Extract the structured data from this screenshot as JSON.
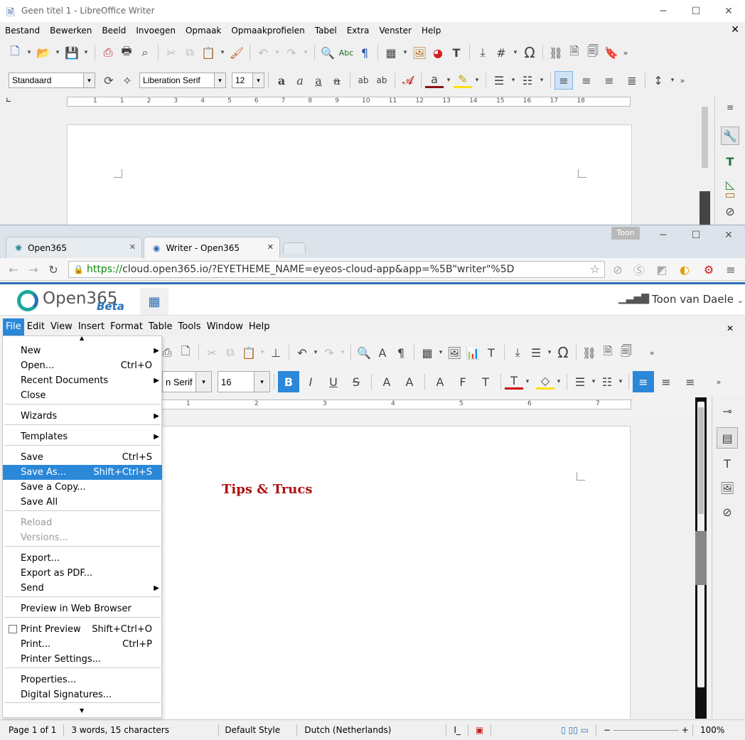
{
  "lo": {
    "title": "Geen titel 1 - LibreOffice Writer",
    "menu": [
      "Bestand",
      "Bewerken",
      "Beeld",
      "Invoegen",
      "Opmaak",
      "Opmaakprofielen",
      "Tabel",
      "Extra",
      "Venster",
      "Help"
    ],
    "style_value": "Standaard",
    "font_value": "Liberation Serif",
    "size_value": "12",
    "ruler_ticks": [
      "1",
      "1",
      "2",
      "3",
      "4",
      "5",
      "6",
      "7",
      "8",
      "9",
      "10",
      "11",
      "12",
      "13",
      "14",
      "15",
      "16",
      "17",
      "18"
    ]
  },
  "browser": {
    "user_badge": "Toon",
    "tabs": [
      {
        "label": "Open365"
      },
      {
        "label": "Writer - Open365"
      }
    ],
    "url_prefix": "https://",
    "url_rest": "cloud.open365.io/?EYETHEME_NAME=eyeos-cloud-app&app=%5B\"writer\"%5D"
  },
  "open365": {
    "logo_text": "Open365",
    "beta": "Beta",
    "user_name": "Toon van Daele",
    "menu": [
      "File",
      "Edit",
      "View",
      "Insert",
      "Format",
      "Table",
      "Tools",
      "Window",
      "Help"
    ],
    "font_value": "n Serif",
    "size_value": "16",
    "doc_heading": "Tips & Trucs",
    "ruler_ticks": [
      "1",
      "2",
      "3",
      "4",
      "5",
      "6",
      "7"
    ]
  },
  "file_menu": {
    "items": [
      {
        "label": "New",
        "accel": "",
        "submenu": true
      },
      {
        "label": "Open...",
        "accel": "Ctrl+O"
      },
      {
        "label": "Recent Documents",
        "accel": "",
        "submenu": true
      },
      {
        "label": "Close",
        "accel": ""
      },
      {
        "label": "Wizards",
        "accel": "",
        "submenu": true
      },
      {
        "label": "Templates",
        "accel": "",
        "submenu": true
      },
      {
        "label": "Save",
        "accel": "Ctrl+S"
      },
      {
        "label": "Save As...",
        "accel": "Shift+Ctrl+S"
      },
      {
        "label": "Save a Copy...",
        "accel": ""
      },
      {
        "label": "Save All",
        "accel": ""
      },
      {
        "label": "Reload",
        "accel": ""
      },
      {
        "label": "Versions...",
        "accel": ""
      },
      {
        "label": "Export...",
        "accel": ""
      },
      {
        "label": "Export as PDF...",
        "accel": ""
      },
      {
        "label": "Send",
        "accel": "",
        "submenu": true
      },
      {
        "label": "Preview in Web Browser",
        "accel": ""
      },
      {
        "label": "Print Preview",
        "accel": "Shift+Ctrl+O"
      },
      {
        "label": "Print...",
        "accel": "Ctrl+P"
      },
      {
        "label": "Printer Settings...",
        "accel": ""
      },
      {
        "label": "Properties...",
        "accel": ""
      },
      {
        "label": "Digital Signatures...",
        "accel": ""
      }
    ]
  },
  "status": {
    "page": "Page 1 of 1",
    "words": "3 words, 15 characters",
    "style": "Default Style",
    "language": "Dutch (Netherlands)",
    "zoom": "100%"
  },
  "colors": {
    "highlight": "#2b88d8",
    "heading": "#b01010",
    "url_green": "#0a8a0a"
  }
}
